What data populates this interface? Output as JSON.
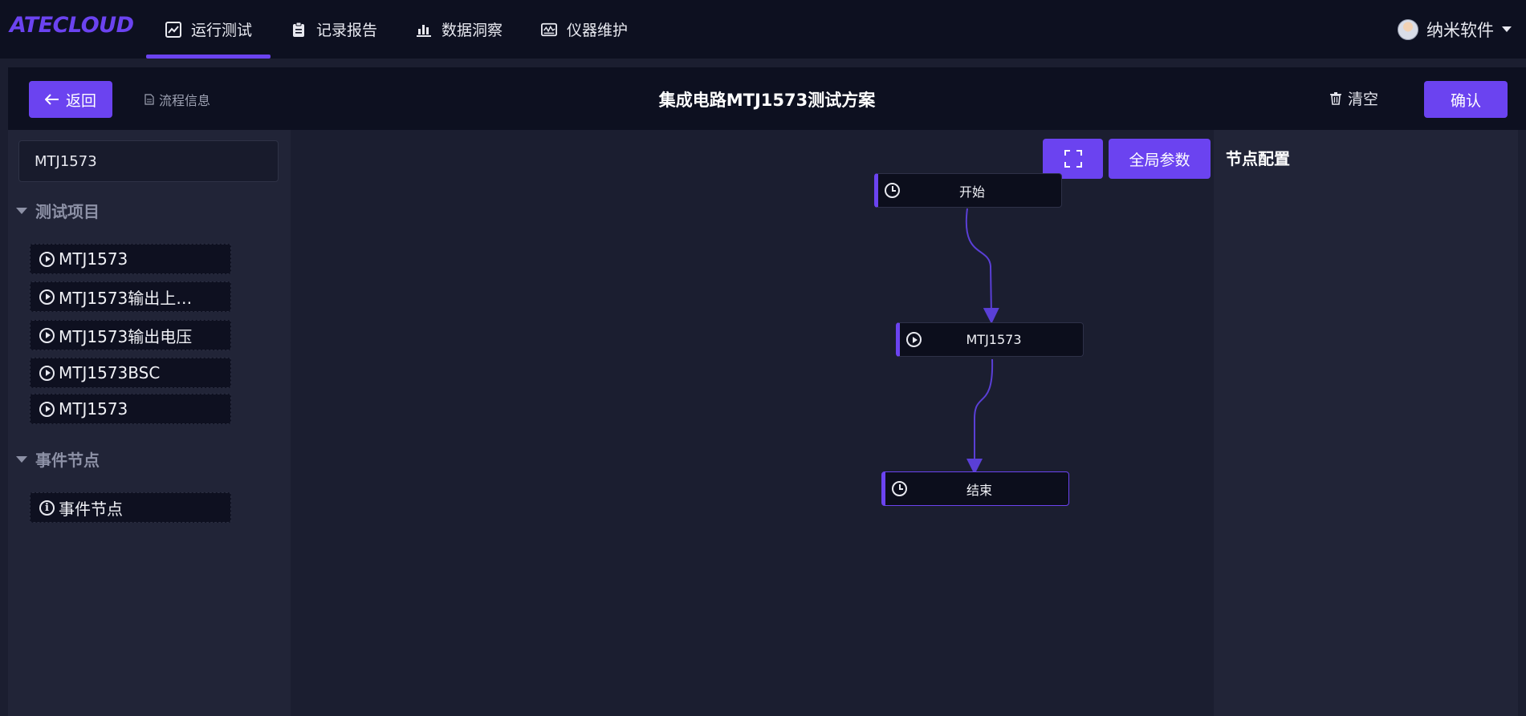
{
  "app": {
    "logo": "ATECLOUD"
  },
  "nav": {
    "items": [
      {
        "label": "运行测试",
        "icon": "line-chart-icon",
        "active": true
      },
      {
        "label": "记录报告",
        "icon": "clipboard-icon",
        "active": false
      },
      {
        "label": "数据洞察",
        "icon": "bar-chart-icon",
        "active": false
      },
      {
        "label": "仪器维护",
        "icon": "instrument-icon",
        "active": false
      }
    ],
    "user": "纳米软件"
  },
  "header": {
    "back_label": "返回",
    "flow_info_label": "流程信息",
    "title": "集成电路MTJ1573测试方案",
    "clear_label": "清空",
    "confirm_label": "确认"
  },
  "left_panel": {
    "search_value": "MTJ1573",
    "groups": [
      {
        "title": "测试项目",
        "items": [
          {
            "label": "MTJ1573",
            "icon": "play-circle-icon"
          },
          {
            "label": "MTJ1573输出上…",
            "icon": "play-circle-icon"
          },
          {
            "label": "MTJ1573输出电压",
            "icon": "play-circle-icon"
          },
          {
            "label": "MTJ1573BSC",
            "icon": "play-circle-icon"
          },
          {
            "label": "MTJ1573",
            "icon": "play-circle-icon"
          }
        ]
      },
      {
        "title": "事件节点",
        "items": [
          {
            "label": "事件节点",
            "icon": "info-circle-icon"
          }
        ]
      }
    ]
  },
  "canvas": {
    "global_params_label": "全局参数",
    "nodes": [
      {
        "label": "开始",
        "icon": "clock-icon"
      },
      {
        "label": "MTJ1573",
        "icon": "play-circle-icon"
      },
      {
        "label": "结束",
        "icon": "clock-icon",
        "selected": true
      }
    ],
    "colors": {
      "accent": "#6b43f0",
      "edge": "#5a3fd6"
    }
  },
  "right_panel": {
    "title": "节点配置"
  }
}
